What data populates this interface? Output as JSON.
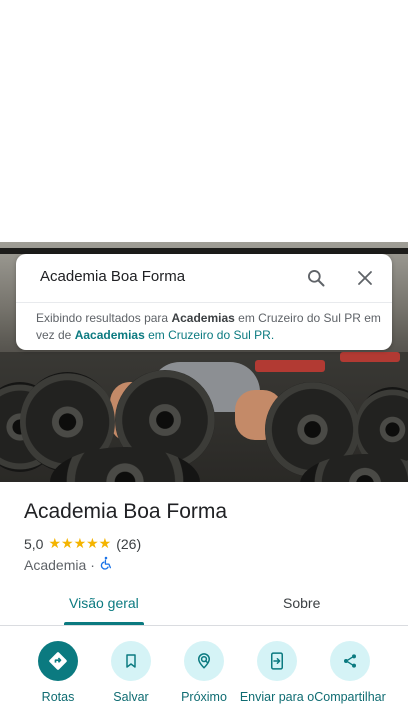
{
  "search": {
    "query": "Academia Boa Forma",
    "notice_prefix": "Exibindo resultados para",
    "notice_term_shown": "Academias",
    "notice_location_shown": "em Cruzeiro do Sul PR",
    "notice_middle": "em vez de",
    "notice_term_original": "Aacademias",
    "notice_location_original": "em Cruzeiro do Sul PR",
    "notice_end": "."
  },
  "place": {
    "name": "Academia Boa Forma",
    "rating": "5,0",
    "stars": "★★★★★",
    "review_count": "(26)",
    "category": "Academia",
    "separator": "·"
  },
  "tabs": [
    {
      "label": "Visão geral",
      "active": true
    },
    {
      "label": "Sobre",
      "active": false
    }
  ],
  "actions": [
    {
      "label": "Rotas",
      "icon": "directions-icon"
    },
    {
      "label": "Salvar",
      "icon": "bookmark-icon"
    },
    {
      "label": "Próximo",
      "icon": "nearby-icon"
    },
    {
      "label": "Enviar para o",
      "icon": "send-to-phone-icon"
    },
    {
      "label": "Compartilhar",
      "icon": "share-icon"
    }
  ],
  "colors": {
    "accent": "#0b7a80",
    "action_bg": "#d5f3f6",
    "star": "#f4b400"
  }
}
